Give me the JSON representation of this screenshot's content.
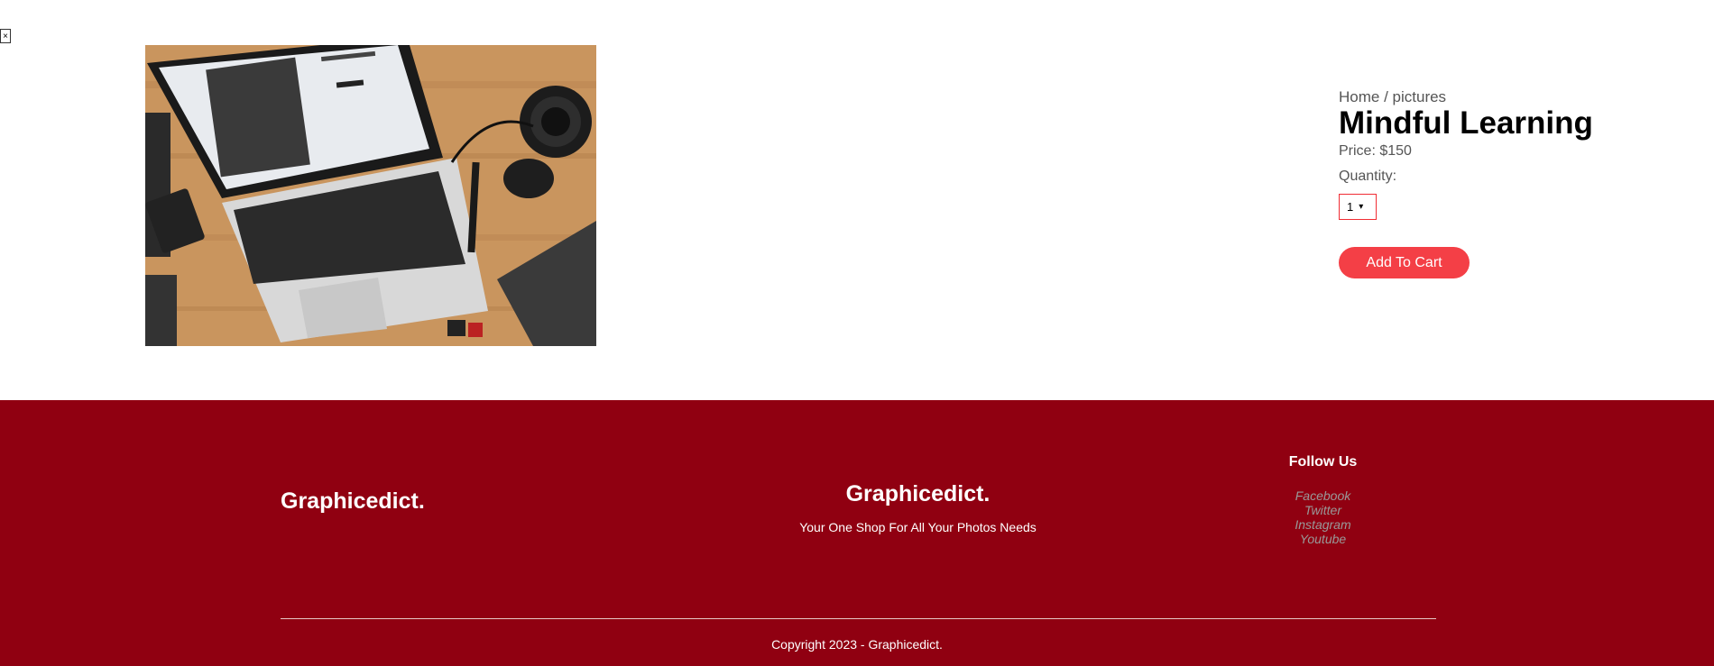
{
  "close_button": {
    "label": "×"
  },
  "product": {
    "breadcrumb": {
      "home": "Home",
      "separator": " / ",
      "category": "pictures"
    },
    "title": "Mindful Learning",
    "price": "Price: $150",
    "quantity_label": "Quantity:",
    "quantity_value": "1",
    "add_to_cart": "Add To Cart"
  },
  "footer": {
    "brand_left": "Graphicedict.",
    "brand_center": "Graphicedict.",
    "tagline": "Your One Shop For All Your Photos Needs",
    "follow_heading": "Follow Us",
    "social_links": [
      "Facebook",
      "Twitter",
      "Instagram",
      "Youtube"
    ],
    "copyright": "Copyright 2023 - Graphicedict."
  },
  "colors": {
    "accent": "#f43f46",
    "footer_bg": "#900011"
  }
}
